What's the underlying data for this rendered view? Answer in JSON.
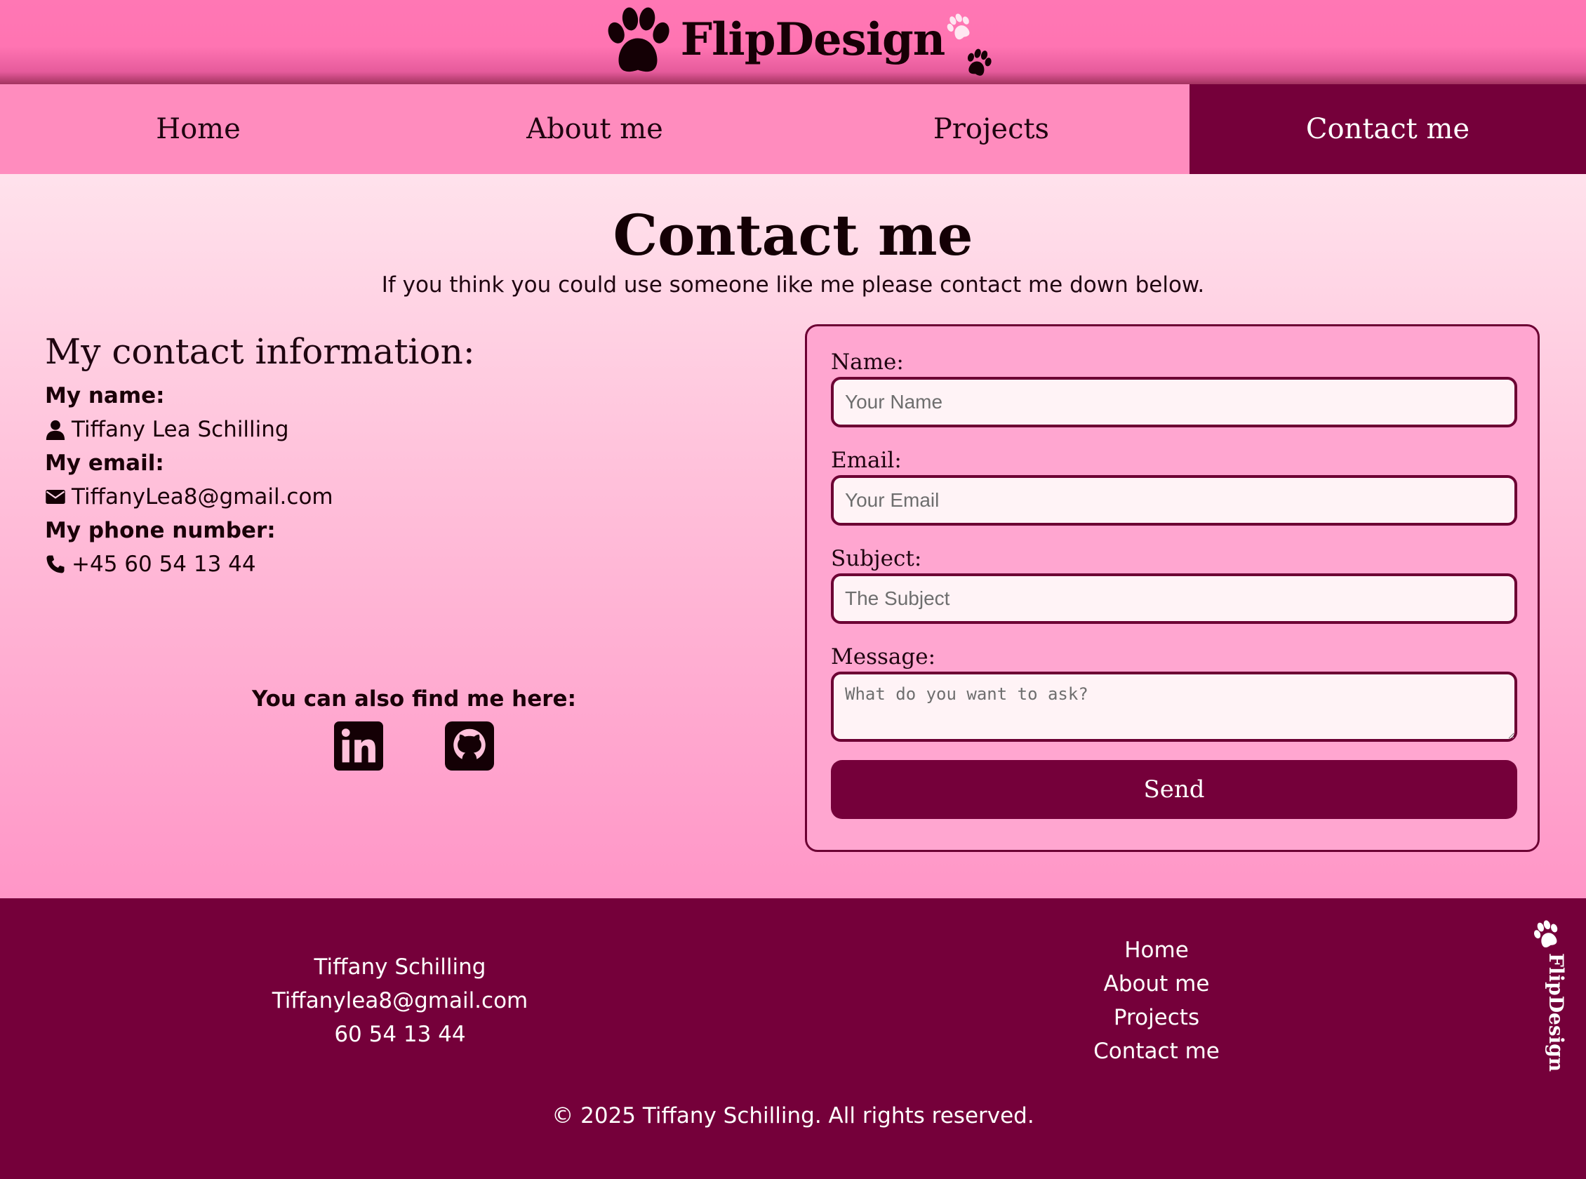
{
  "header": {
    "logo_text": "FlipDesign",
    "logo_icon": "paw-icon"
  },
  "nav": {
    "items": [
      {
        "label": "Home",
        "active": false
      },
      {
        "label": "About me",
        "active": false
      },
      {
        "label": "Projects",
        "active": false
      },
      {
        "label": "Contact me",
        "active": true
      }
    ]
  },
  "main": {
    "title": "Contact me",
    "intro": "If you think you could use someone like me please contact me down below.",
    "contact_info": {
      "heading": "My contact information:",
      "name_label": "My name:",
      "name_value": "Tiffany Lea Schilling",
      "email_label": "My email:",
      "email_value": "TiffanyLea8@gmail.com",
      "phone_label": "My phone number:",
      "phone_value": "+45 60 54 13 44"
    },
    "find_me": {
      "text": "You can also find me here:",
      "icons": [
        "linkedin-icon",
        "github-icon"
      ]
    }
  },
  "form": {
    "name_label": "Name:",
    "name_placeholder": "Your Name",
    "email_label": "Email:",
    "email_placeholder": "Your Email",
    "subject_label": "Subject:",
    "subject_placeholder": "The Subject",
    "message_label": "Message:",
    "message_placeholder": "What do you want to ask?",
    "send_label": "Send"
  },
  "footer": {
    "name": "Tiffany Schilling",
    "email": "Tiffanylea8@gmail.com",
    "phone": "60 54 13 44",
    "links": [
      "Home",
      "About me",
      "Projects",
      "Contact me"
    ],
    "logo_text": "FlipDesign",
    "copyright": "© 2025 Tiffany Schilling. All rights reserved."
  },
  "colors": {
    "header_pink": "#ff77b4",
    "nav_pink": "#ff8cbe",
    "accent_dark": "#75003a",
    "form_bg": "#ffa6d0"
  }
}
